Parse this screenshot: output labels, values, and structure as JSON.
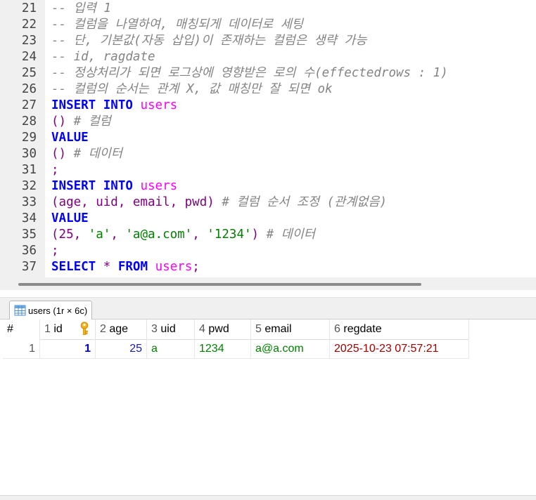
{
  "editor": {
    "lines": [
      {
        "n": "21",
        "segs": [
          {
            "t": "-- 입력 1",
            "c": "cm"
          }
        ]
      },
      {
        "n": "22",
        "segs": [
          {
            "t": "-- 컬럼을 나열하여, 매칭되게 데이터로 세팅",
            "c": "cm"
          }
        ]
      },
      {
        "n": "23",
        "segs": [
          {
            "t": "-- 단, 기본값(자동 삽입)이 존재하는 컬럼은 생략 가능",
            "c": "cm"
          }
        ]
      },
      {
        "n": "24",
        "segs": [
          {
            "t": "-- id, ragdate",
            "c": "cm"
          }
        ]
      },
      {
        "n": "25",
        "segs": [
          {
            "t": "-- 정상처리가 되면 로그상에 영향받은 로의 수(effectedrows : 1)",
            "c": "cm"
          }
        ]
      },
      {
        "n": "26",
        "segs": [
          {
            "t": "-- 컬럼의 순서는 관계 X, 값 매칭만 잘 되면 ok",
            "c": "cm"
          }
        ]
      },
      {
        "n": "27",
        "segs": [
          {
            "t": "INSERT",
            "c": "kw"
          },
          {
            "t": " "
          },
          {
            "t": "INTO",
            "c": "kw"
          },
          {
            "t": " "
          },
          {
            "t": "users",
            "c": "tbl"
          }
        ]
      },
      {
        "n": "28",
        "segs": [
          {
            "t": "()",
            "c": "op"
          },
          {
            "t": " "
          },
          {
            "t": "# 컬럼",
            "c": "cm"
          }
        ]
      },
      {
        "n": "29",
        "segs": [
          {
            "t": "VALUE",
            "c": "kw"
          }
        ]
      },
      {
        "n": "30",
        "segs": [
          {
            "t": "()",
            "c": "op"
          },
          {
            "t": " "
          },
          {
            "t": "# 데이터",
            "c": "cm"
          }
        ]
      },
      {
        "n": "31",
        "segs": [
          {
            "t": ";",
            "c": "op"
          }
        ]
      },
      {
        "n": "32",
        "segs": [
          {
            "t": "INSERT",
            "c": "kw"
          },
          {
            "t": " "
          },
          {
            "t": "INTO",
            "c": "kw"
          },
          {
            "t": " "
          },
          {
            "t": "users",
            "c": "tbl"
          }
        ]
      },
      {
        "n": "33",
        "segs": [
          {
            "t": "(age, uid, email, pwd)",
            "c": "col"
          },
          {
            "t": " "
          },
          {
            "t": "# 컬럼 순서 조정 (관계없음)",
            "c": "cm"
          }
        ]
      },
      {
        "n": "34",
        "segs": [
          {
            "t": "VALUE",
            "c": "kw"
          }
        ]
      },
      {
        "n": "35",
        "segs": [
          {
            "t": "(",
            "c": "op"
          },
          {
            "t": "25",
            "c": "num"
          },
          {
            "t": ", ",
            "c": "op"
          },
          {
            "t": "'a'",
            "c": "str"
          },
          {
            "t": ", ",
            "c": "op"
          },
          {
            "t": "'a@a.com'",
            "c": "str"
          },
          {
            "t": ", ",
            "c": "op"
          },
          {
            "t": "'1234'",
            "c": "str"
          },
          {
            "t": ")",
            "c": "op"
          },
          {
            "t": " "
          },
          {
            "t": "# 데이터",
            "c": "cm"
          }
        ]
      },
      {
        "n": "36",
        "segs": [
          {
            "t": ";",
            "c": "op"
          }
        ]
      },
      {
        "n": "37",
        "segs": [
          {
            "t": "SELECT",
            "c": "kw"
          },
          {
            "t": " "
          },
          {
            "t": "*",
            "c": "op"
          },
          {
            "t": " "
          },
          {
            "t": "FROM",
            "c": "kw"
          },
          {
            "t": " "
          },
          {
            "t": "users",
            "c": "tbl"
          },
          {
            "t": ";",
            "c": "op"
          }
        ]
      }
    ]
  },
  "result_tab": {
    "label": "users (1r × 6c)",
    "icon": "table-grid-icon"
  },
  "grid": {
    "row_header": "#",
    "columns": [
      {
        "idx": "1",
        "name": "id",
        "key_icon": "primary-key-icon"
      },
      {
        "idx": "2",
        "name": "age"
      },
      {
        "idx": "3",
        "name": "uid"
      },
      {
        "idx": "4",
        "name": "pwd"
      },
      {
        "idx": "5",
        "name": "email"
      },
      {
        "idx": "6",
        "name": "regdate"
      }
    ],
    "rows": [
      {
        "row_no": "1",
        "id": "1",
        "age": "25",
        "uid": "a",
        "pwd": "1234",
        "email": "a@a.com",
        "regdate": "2025-10-23 07:57:21"
      }
    ]
  },
  "colors": {
    "keyword": "#0000ff",
    "table": "#ff00ff",
    "comment": "#848484",
    "string": "#008000",
    "column": "#800080",
    "date": "#a00000"
  }
}
